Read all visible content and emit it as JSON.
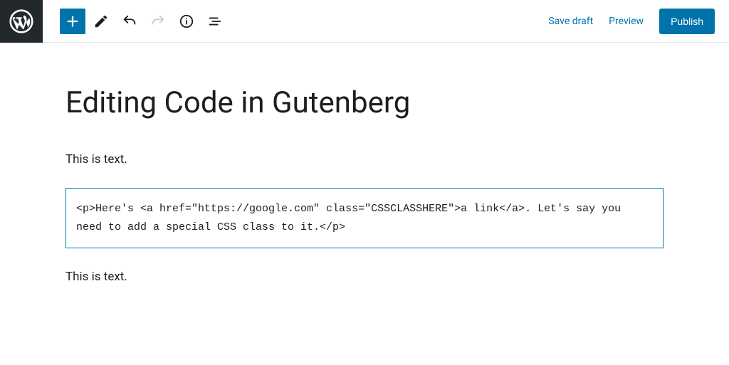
{
  "toolbar": {
    "save_draft": "Save draft",
    "preview": "Preview",
    "publish": "Publish"
  },
  "editor": {
    "title": "Editing Code in Gutenberg",
    "block1": "This is text.",
    "code_block": "<p>Here's <a href=\"https://google.com\" class=\"CSSCLASSHERE\">a link</a>. Let's say you need to add a special CSS class to it.</p>",
    "block2": "This is text."
  }
}
